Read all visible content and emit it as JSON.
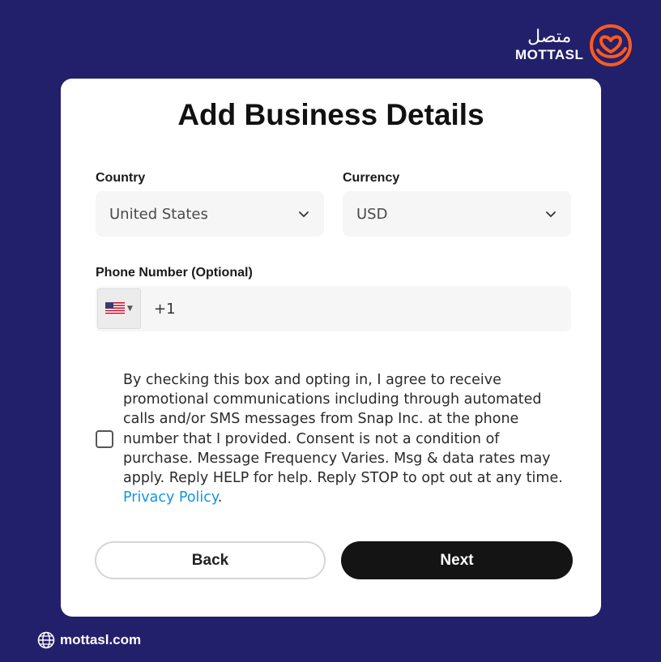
{
  "brand": {
    "arabic_name": "متصل",
    "latin_name": "MOTTASL",
    "accent_color": "#ff5a1f"
  },
  "form": {
    "title": "Add Business Details",
    "country": {
      "label": "Country",
      "value": "United States"
    },
    "currency": {
      "label": "Currency",
      "value": "USD"
    },
    "phone": {
      "label": "Phone Number (Optional)",
      "value": "+1",
      "flag_icon": "us-flag-icon"
    },
    "consent": {
      "checked": false,
      "text": "By checking this box and opting in, I agree to receive promotional communications including through automated calls and/or SMS messages from Snap Inc. at the phone number that I provided. Consent is not a condition of purchase. Message Frequency Varies. Msg & data rates may apply. Reply HELP for help. Reply STOP to opt out at any time. ",
      "link_text": "Privacy Policy",
      "trailing": "."
    },
    "back_label": "Back",
    "next_label": "Next"
  },
  "footer": {
    "website": "mottasl.com"
  }
}
